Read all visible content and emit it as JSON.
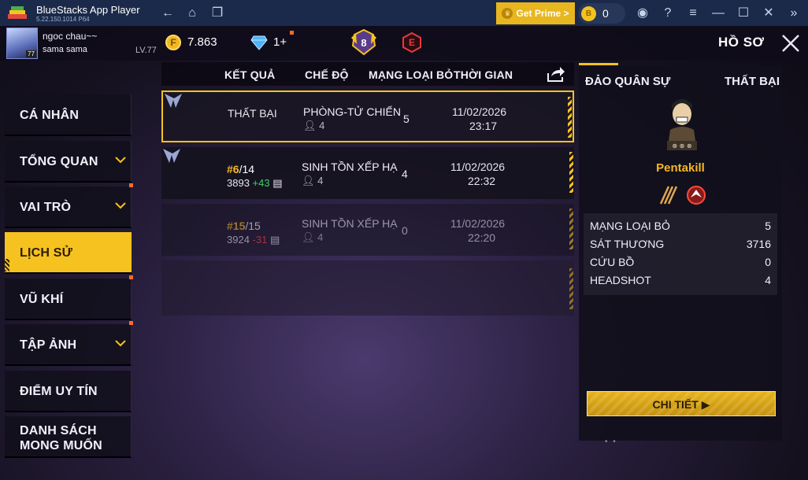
{
  "window": {
    "app_title": "BlueStacks App Player",
    "version": "5.22.150.1014  P64",
    "prime_label": "Get Prime >",
    "coins": "0"
  },
  "player": {
    "name": "ngoc chau~~",
    "signature": "sama sama",
    "level": "LV.77",
    "avatar_level": "77",
    "gold": "7.863",
    "diamonds": "1+",
    "rank_number": "8",
    "rank_letter": "E"
  },
  "page_title": "HỒ SƠ",
  "sidebar": {
    "items": [
      {
        "label": "CÁ NHÂN"
      },
      {
        "label": "TỔNG QUAN"
      },
      {
        "label": "VAI TRÒ"
      },
      {
        "label": "LỊCH SỬ"
      },
      {
        "label": "VŨ KHÍ"
      },
      {
        "label": "TẬP ẢNH"
      },
      {
        "label": "ĐIỂM UY TÍN"
      },
      {
        "label_line1": "DANH SÁCH",
        "label_line2": "MONG MUỐN"
      }
    ]
  },
  "table": {
    "headers": {
      "result": "KẾT QUẢ",
      "mode": "CHẾ ĐỘ",
      "kills": "MẠNG LOẠI BỎ",
      "time": "THỜI GIAN"
    },
    "rows": [
      {
        "result": "THẤT BẠI",
        "mode": "PHÒNG-TỬ CHIẾN",
        "players": "4",
        "kills": "5",
        "date": "11/02/2026",
        "time": "23:17"
      },
      {
        "pos_rank": "#6",
        "pos_total": "/14",
        "score": "3893",
        "delta": "+43",
        "mode": "SINH TỒN XẾP HẠ",
        "players": "4",
        "kills": "4",
        "date": "11/02/2026",
        "time": "22:32"
      },
      {
        "pos_rank": "#15",
        "pos_total": "/15",
        "score": "3924",
        "delta": "-31",
        "mode": "SINH TỒN XẾP HẠ",
        "players": "4",
        "kills": "0",
        "date": "11/02/2026",
        "time": "22:20"
      }
    ]
  },
  "detail": {
    "map": "ĐẢO QUÂN SỰ",
    "result": "THẤT BẠI",
    "character": "Pentakill",
    "stats": [
      {
        "label": "MẠNG LOẠI BỎ",
        "value": "5"
      },
      {
        "label": "SÁT THƯƠNG",
        "value": "3716"
      },
      {
        "label": "CỨU BỒ",
        "value": "0"
      },
      {
        "label": "HEADSHOT",
        "value": "4"
      }
    ],
    "button": "CHI TIẾT"
  },
  "colors": {
    "accent": "#f6c21f",
    "positive": "#3ed06a",
    "negative": "#ff3e3e",
    "rank_orange": "#f6b820"
  }
}
